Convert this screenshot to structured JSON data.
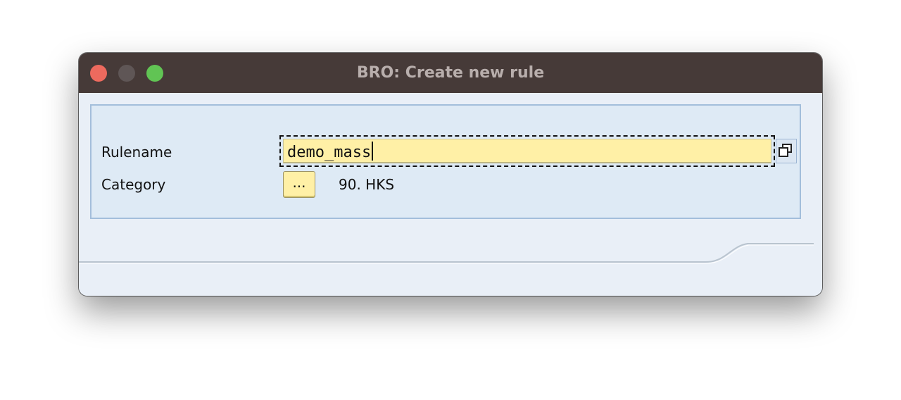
{
  "window": {
    "title": "BRO: Create new rule"
  },
  "form": {
    "rulename_label": "Rulename",
    "rulename_value": "demo_mass",
    "category_label": "Category",
    "category_button_label": "...",
    "category_value": "90. HKS"
  },
  "icons": {
    "window_controls": [
      "close-icon",
      "minimize-icon",
      "zoom-icon"
    ],
    "rulename_help": "copy-icon",
    "confirm": "checkmark-icon",
    "cancel": "cross-icon"
  },
  "colors": {
    "titlebar": "#463a38",
    "input_background": "#fff0a6",
    "panel_background": "#deeaf5",
    "confirm_green": "#3a9a22",
    "cancel_red": "#cc1f1f"
  }
}
